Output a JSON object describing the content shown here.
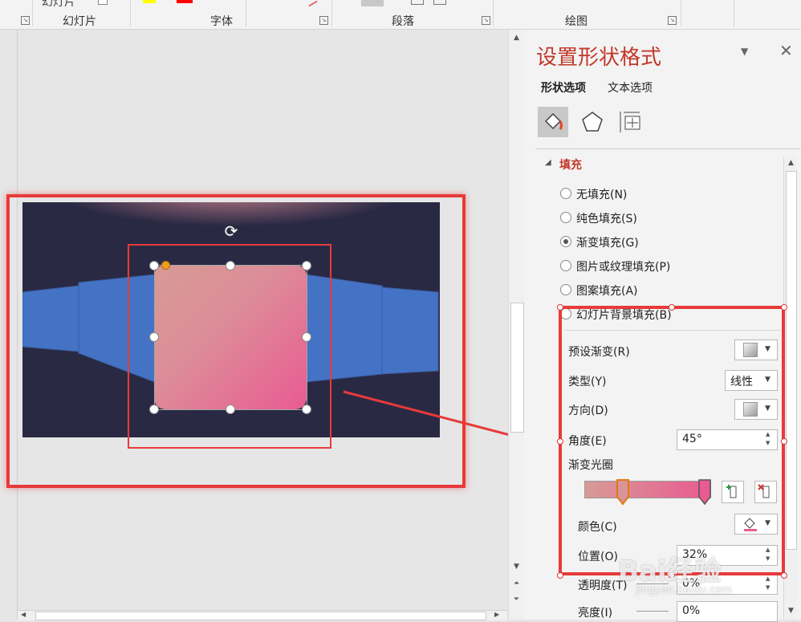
{
  "ribbon": {
    "groups": {
      "slides": "幻灯片",
      "font": "字体",
      "paragraph": "段落",
      "drawing": "绘图"
    },
    "top_clip_text": "幻灯片"
  },
  "panel": {
    "title": "设置形状格式",
    "tabs": [
      "形状选项",
      "文本选项"
    ],
    "section": "填充",
    "fill_options": [
      {
        "label": "无填充(N)",
        "selected": false
      },
      {
        "label": "纯色填充(S)",
        "selected": false
      },
      {
        "label": "渐变填充(G)",
        "selected": true
      },
      {
        "label": "图片或纹理填充(P)",
        "selected": false
      },
      {
        "label": "图案填充(A)",
        "selected": false
      },
      {
        "label": "幻灯片背景填充(B)",
        "selected": false
      }
    ],
    "props": {
      "preset_label": "预设渐变(R)",
      "type_label": "类型(Y)",
      "type_value": "线性",
      "direction_label": "方向(D)",
      "angle_label": "角度(E)",
      "angle_value": "45°",
      "stops_label": "渐变光圈",
      "color_label": "颜色(C)",
      "position_label": "位置(O)",
      "position_value": "32%",
      "transparency_label": "透明度(T)",
      "transparency_value": "0%",
      "brightness_label": "亮度(I)",
      "brightness_value": "0%"
    }
  },
  "colors": {
    "slide_bg": "#2a2944",
    "band": "#4472c4",
    "grad_start": "#d79a95",
    "grad_end": "#e95b92",
    "annotation": "#e83a3a",
    "panel_title": "#c0392b"
  },
  "watermark": {
    "brand": "Bai经验",
    "url": "jingyan.baidu.com"
  }
}
